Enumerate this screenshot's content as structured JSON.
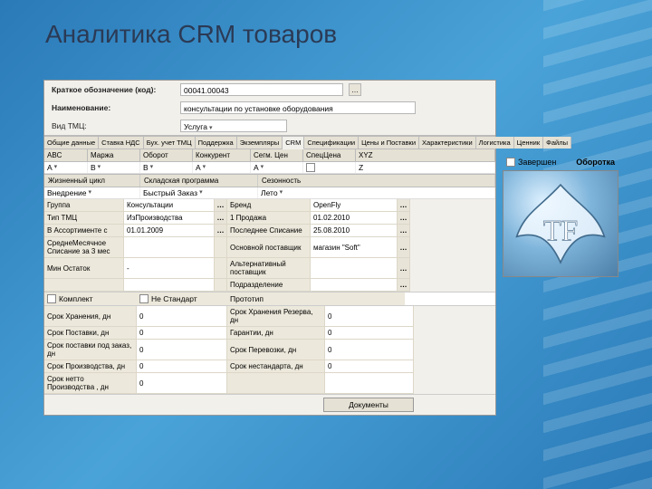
{
  "slide": {
    "title": "Аналитика CRM товаров"
  },
  "header": {
    "code_label": "Краткое обозначение (код):",
    "code_value": "00041.00043",
    "name_label": "Наименование:",
    "name_value": "консультации по установке оборудования",
    "type_label": "Вид ТМЦ:",
    "type_value": "Услуга"
  },
  "tabs": [
    "Общие данные",
    "Ставка НДС",
    "Бух. учет ТМЦ",
    "Поддержка",
    "Экземпляры",
    "CRM",
    "Спецификации",
    "Цены и Поставки",
    "Характеристики",
    "Логистика",
    "Ценник",
    "Файлы"
  ],
  "active_tab": "CRM",
  "abc_headers": {
    "abc": "ABC",
    "margin": "Маржа",
    "turnover": "Оборот",
    "competitor": "Конкурент",
    "segment": "Сегм. Цен",
    "spec": "СпецЦена",
    "xyz": "XYZ"
  },
  "abc_values": {
    "abc": "A",
    "margin": "B",
    "turnover": "B",
    "competitor": "A",
    "segment": "A",
    "spec": "",
    "xyz": "Z"
  },
  "section2": {
    "life_cycle": "Жизненный цикл",
    "life_val": "Внедрение",
    "stock_prog": "Складская программа",
    "stock_val": "Быстрый Заказ",
    "season": "Сезонность",
    "season_val": "Лето"
  },
  "formrows": [
    {
      "l1": "Группа",
      "v1": "Консультации",
      "b1": "…",
      "l2": "Бренд",
      "v2": "OpenFly",
      "b2": "…"
    },
    {
      "l1": "Тип ТМЦ",
      "v1": "ИзПроизводства",
      "b1": "…",
      "l2": "1 Продажа",
      "v2": "01.02.2010",
      "b2": "…"
    },
    {
      "l1": "В Ассортименте с",
      "v1": "01.01.2009",
      "b1": "…",
      "l2": "Последнее Списание",
      "v2": "25.08.2010",
      "b2": "…"
    },
    {
      "l1": "СреднеМесячное Списание за 3 мес",
      "v1": "",
      "b1": "",
      "l2": "Основной поставщик",
      "v2": "магазин \"Soft\"",
      "b2": "…"
    },
    {
      "l1": "Мин Остаток",
      "v1": "-",
      "b1": "",
      "l2": "Альтернативный поставщик",
      "v2": "",
      "b2": "…"
    },
    {
      "l1": "",
      "v1": "",
      "b1": "",
      "l2": "Подразделение",
      "v2": "",
      "b2": "…"
    }
  ],
  "checks": {
    "komplekt": "Комплект",
    "nestd": "Не Стандарт",
    "prototype": "Прототип",
    "zavershen": "Завершен"
  },
  "bottomrows": [
    {
      "l1": "Срок Хранения, дн",
      "v1": "0",
      "l2": "Срок Хранения Резерва, дн",
      "v2": "0"
    },
    {
      "l1": "Срок Поставки, дн",
      "v1": "0",
      "l2": "Гарантии, дн",
      "v2": "0"
    },
    {
      "l1": "Срок поставки под заказ, дн",
      "v1": "0",
      "l2": "Срок Перевозки, дн",
      "v2": "0"
    },
    {
      "l1": "Срок Производства, дн",
      "v1": "0",
      "l2": "Срок нестандарта, дн",
      "v2": "0"
    },
    {
      "l1": "Срок нетто Производства , дн",
      "v1": "0",
      "l2": "",
      "v2": ""
    }
  ],
  "documents_btn": "Документы",
  "side": {
    "oborotka": "Оборотка",
    "logo": "TF"
  }
}
